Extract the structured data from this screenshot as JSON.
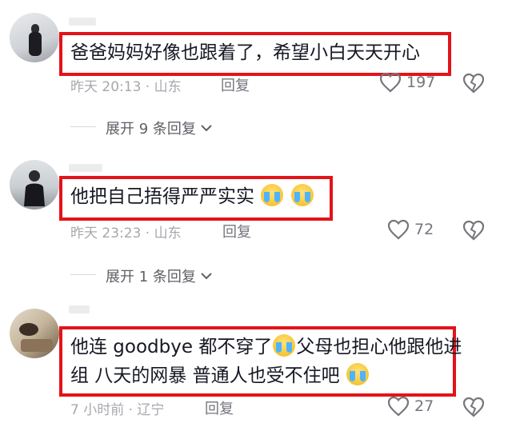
{
  "comments": [
    {
      "text": "爸爸妈妈好像也跟着了，希望小白天天开心",
      "time": "昨天 20:13 · 山东",
      "reply": "回复",
      "likes": "197",
      "expand": "展开 9 条回复"
    },
    {
      "text": "他把自己捂得严严实实",
      "time": "昨天 23:23 · 山东",
      "reply": "回复",
      "likes": "72",
      "expand": "展开 1 条回复"
    },
    {
      "text_line1": "他连 goodbye 都不穿了",
      "text_line1b": "父母也担心他跟他进",
      "text_line2": "组 八天的网暴 普通人也受不住吧",
      "time": "7 小时前 · 辽宁",
      "reply": "回复",
      "likes": "27"
    }
  ],
  "icons": {
    "heart": "heart-icon",
    "dislike": "broken-heart-icon",
    "chevron": "chevron-down-icon",
    "emoji": "crying-face-emoji"
  },
  "colors": {
    "highlight_border": "#e3131a",
    "meta_text": "#a7a8ad"
  }
}
